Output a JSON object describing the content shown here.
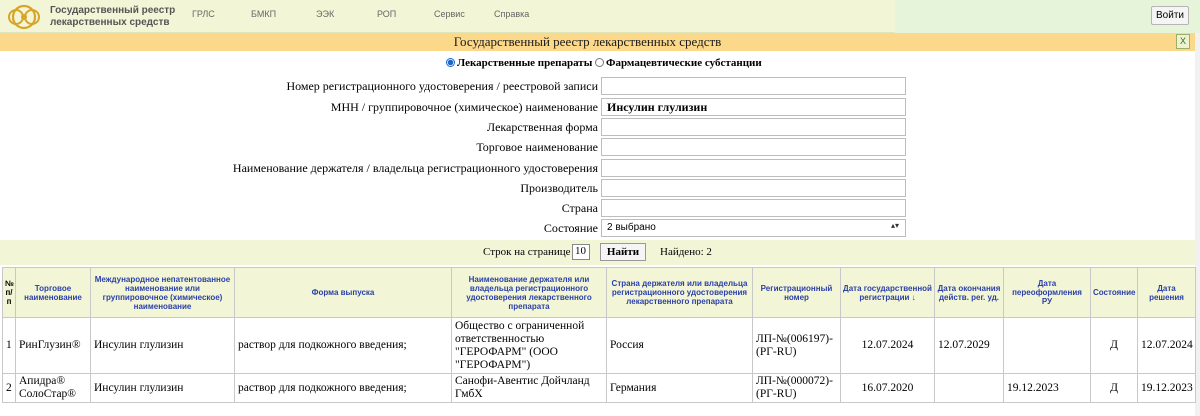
{
  "header": {
    "logo_line1": "Государственный реестр",
    "logo_line2": "лекарственных средств",
    "nav": [
      "ГРЛС",
      "БМКП",
      "ЭЭК",
      "РОП",
      "Сервис",
      "Справка"
    ],
    "login_label": "Войти"
  },
  "title": "Государственный реестр лекарственных средств",
  "excel_icon_label": "X",
  "radio": {
    "option1": "Лекарственные препараты",
    "option2": "Фармацевтические субстанции",
    "selected": "option1"
  },
  "form": {
    "fields": [
      {
        "label": "Номер регистрационного удостоверения / реестровой записи",
        "value": ""
      },
      {
        "label": "МНН / группировочное (химическое) наименование",
        "value": "Инсулин глулизин"
      },
      {
        "label": "Лекарственная форма",
        "value": ""
      },
      {
        "label": "Торговое наименование",
        "value": ""
      },
      {
        "label": "Наименование держателя / владельца регистрационного удостоверения",
        "value": ""
      },
      {
        "label": "Производитель",
        "value": ""
      },
      {
        "label": "Страна",
        "value": ""
      }
    ],
    "state_label": "Состояние",
    "state_value": "2 выбрано"
  },
  "search": {
    "rows_label": "Строк на странице",
    "rows_value": "10",
    "find_label": "Найти",
    "found_text": "Найдено: 2"
  },
  "table": {
    "headers": [
      "№ п/п",
      "Торговое наименование",
      "Международное непатентованное наименование или группировочное (химическое) наименование",
      "Форма выпуска",
      "Наименование держателя или владельца регистрационного удостоверения лекарственного препарата",
      "Страна держателя или владельца регистрационного удостоверения лекарственного препарата",
      "Регистрационный номер",
      "Дата государственной регистрации ↓",
      "Дата окончания действ. рег. уд.",
      "Дата переоформления РУ",
      "Состояние",
      "Дата решения"
    ],
    "rows": [
      [
        "1",
        "РинГлузин®",
        "Инсулин глулизин",
        "раствор для подкожного введения;",
        "Общество с ограниченной ответственностью \"ГЕРОФАРМ\" (ООО \"ГЕРОФАРМ\")",
        "Россия",
        "ЛП-№(006197)-(РГ-RU)",
        "12.07.2024",
        "12.07.2029",
        "",
        "Д",
        "12.07.2024"
      ],
      [
        "2",
        "Апидра® СолоСтар®",
        "Инсулин глулизин",
        "раствор для подкожного введения;",
        "Санофи-Авентис Дойчланд ГмбХ",
        "Германия",
        "ЛП-№(000072)-(РГ-RU)",
        "16.07.2020",
        "",
        "19.12.2023",
        "Д",
        "19.12.2023"
      ]
    ]
  }
}
